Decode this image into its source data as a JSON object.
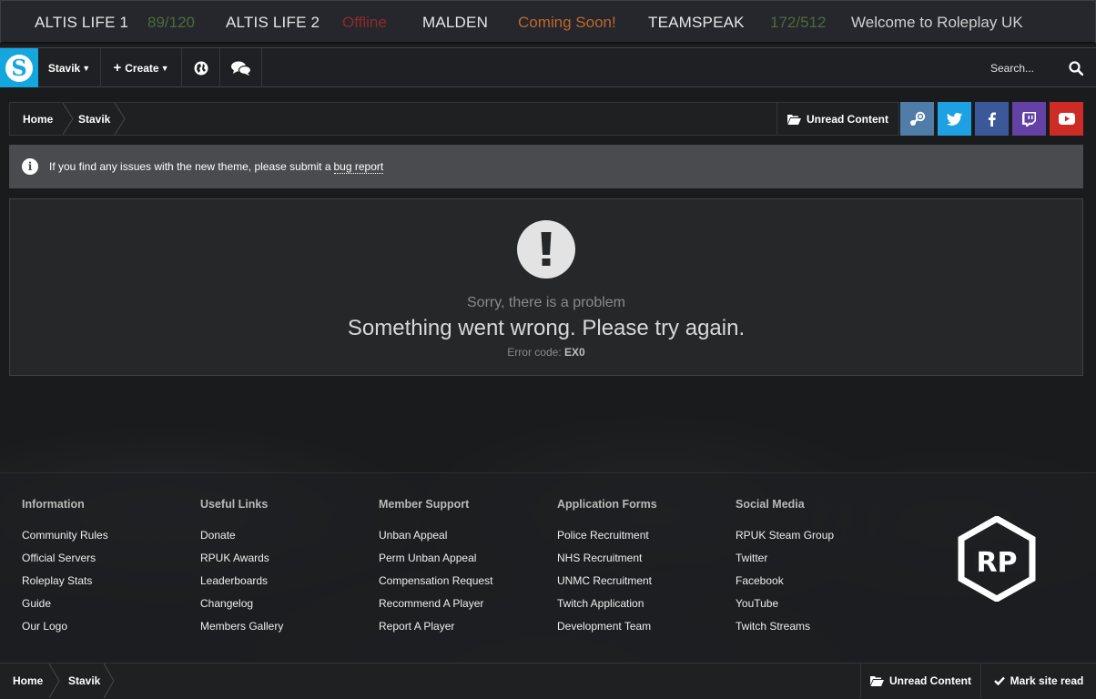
{
  "server_bar": {
    "servers": [
      {
        "name": "ALTIS LIFE 1",
        "status": "89/120"
      },
      {
        "name": "ALTIS LIFE 2",
        "status": "Offline"
      },
      {
        "name": "MALDEN",
        "status": "Coming Soon!"
      },
      {
        "name": "TEAMSPEAK",
        "status": "172/512"
      }
    ],
    "welcome": "Welcome to Roleplay UK"
  },
  "nav": {
    "user": "Stavik",
    "create": "Create",
    "search_placeholder": "Search..."
  },
  "breadcrumb": {
    "items": [
      "Home",
      "Stavik"
    ],
    "unread": "Unread Content"
  },
  "social_buttons": [
    {
      "icon": "steam-icon",
      "color": "#4f7da8"
    },
    {
      "icon": "twitter-icon",
      "color": "#1da1e2"
    },
    {
      "icon": "facebook-icon",
      "color": "#3b5998"
    },
    {
      "icon": "twitch-icon",
      "color": "#6441a5"
    },
    {
      "icon": "youtube-icon",
      "color": "#cc2b26"
    }
  ],
  "notice": {
    "text": "If you find any issues with the new theme, please submit a",
    "link": "bug report"
  },
  "error": {
    "subtitle": "Sorry, there is a problem",
    "message": "Something went wrong. Please try again.",
    "code_label": "Error code:",
    "code": "EX0"
  },
  "footer": {
    "columns": [
      {
        "title": "Information",
        "links": [
          "Community Rules",
          "Official Servers",
          "Roleplay Stats",
          "Guide",
          "Our Logo"
        ]
      },
      {
        "title": "Useful Links",
        "links": [
          "Donate",
          "RPUK Awards",
          "Leaderboards",
          "Changelog",
          "Members Gallery"
        ]
      },
      {
        "title": "Member Support",
        "links": [
          "Unban Appeal",
          "Perm Unban Appeal",
          "Compensation Request",
          "Recommend A Player",
          "Report A Player"
        ]
      },
      {
        "title": "Application Forms",
        "links": [
          "Police Recruitment",
          "NHS Recruitment",
          "UNMC Recruitment",
          "Twitch Application",
          "Development Team"
        ]
      },
      {
        "title": "Social Media",
        "links": [
          "RPUK Steam Group",
          "Twitter",
          "Facebook",
          "YouTube",
          "Twitch Streams"
        ]
      }
    ],
    "logo_text": "RP"
  },
  "bottom_bar": {
    "items": [
      "Home",
      "Stavik"
    ],
    "unread": "Unread Content",
    "mark_read": "Mark site read"
  }
}
